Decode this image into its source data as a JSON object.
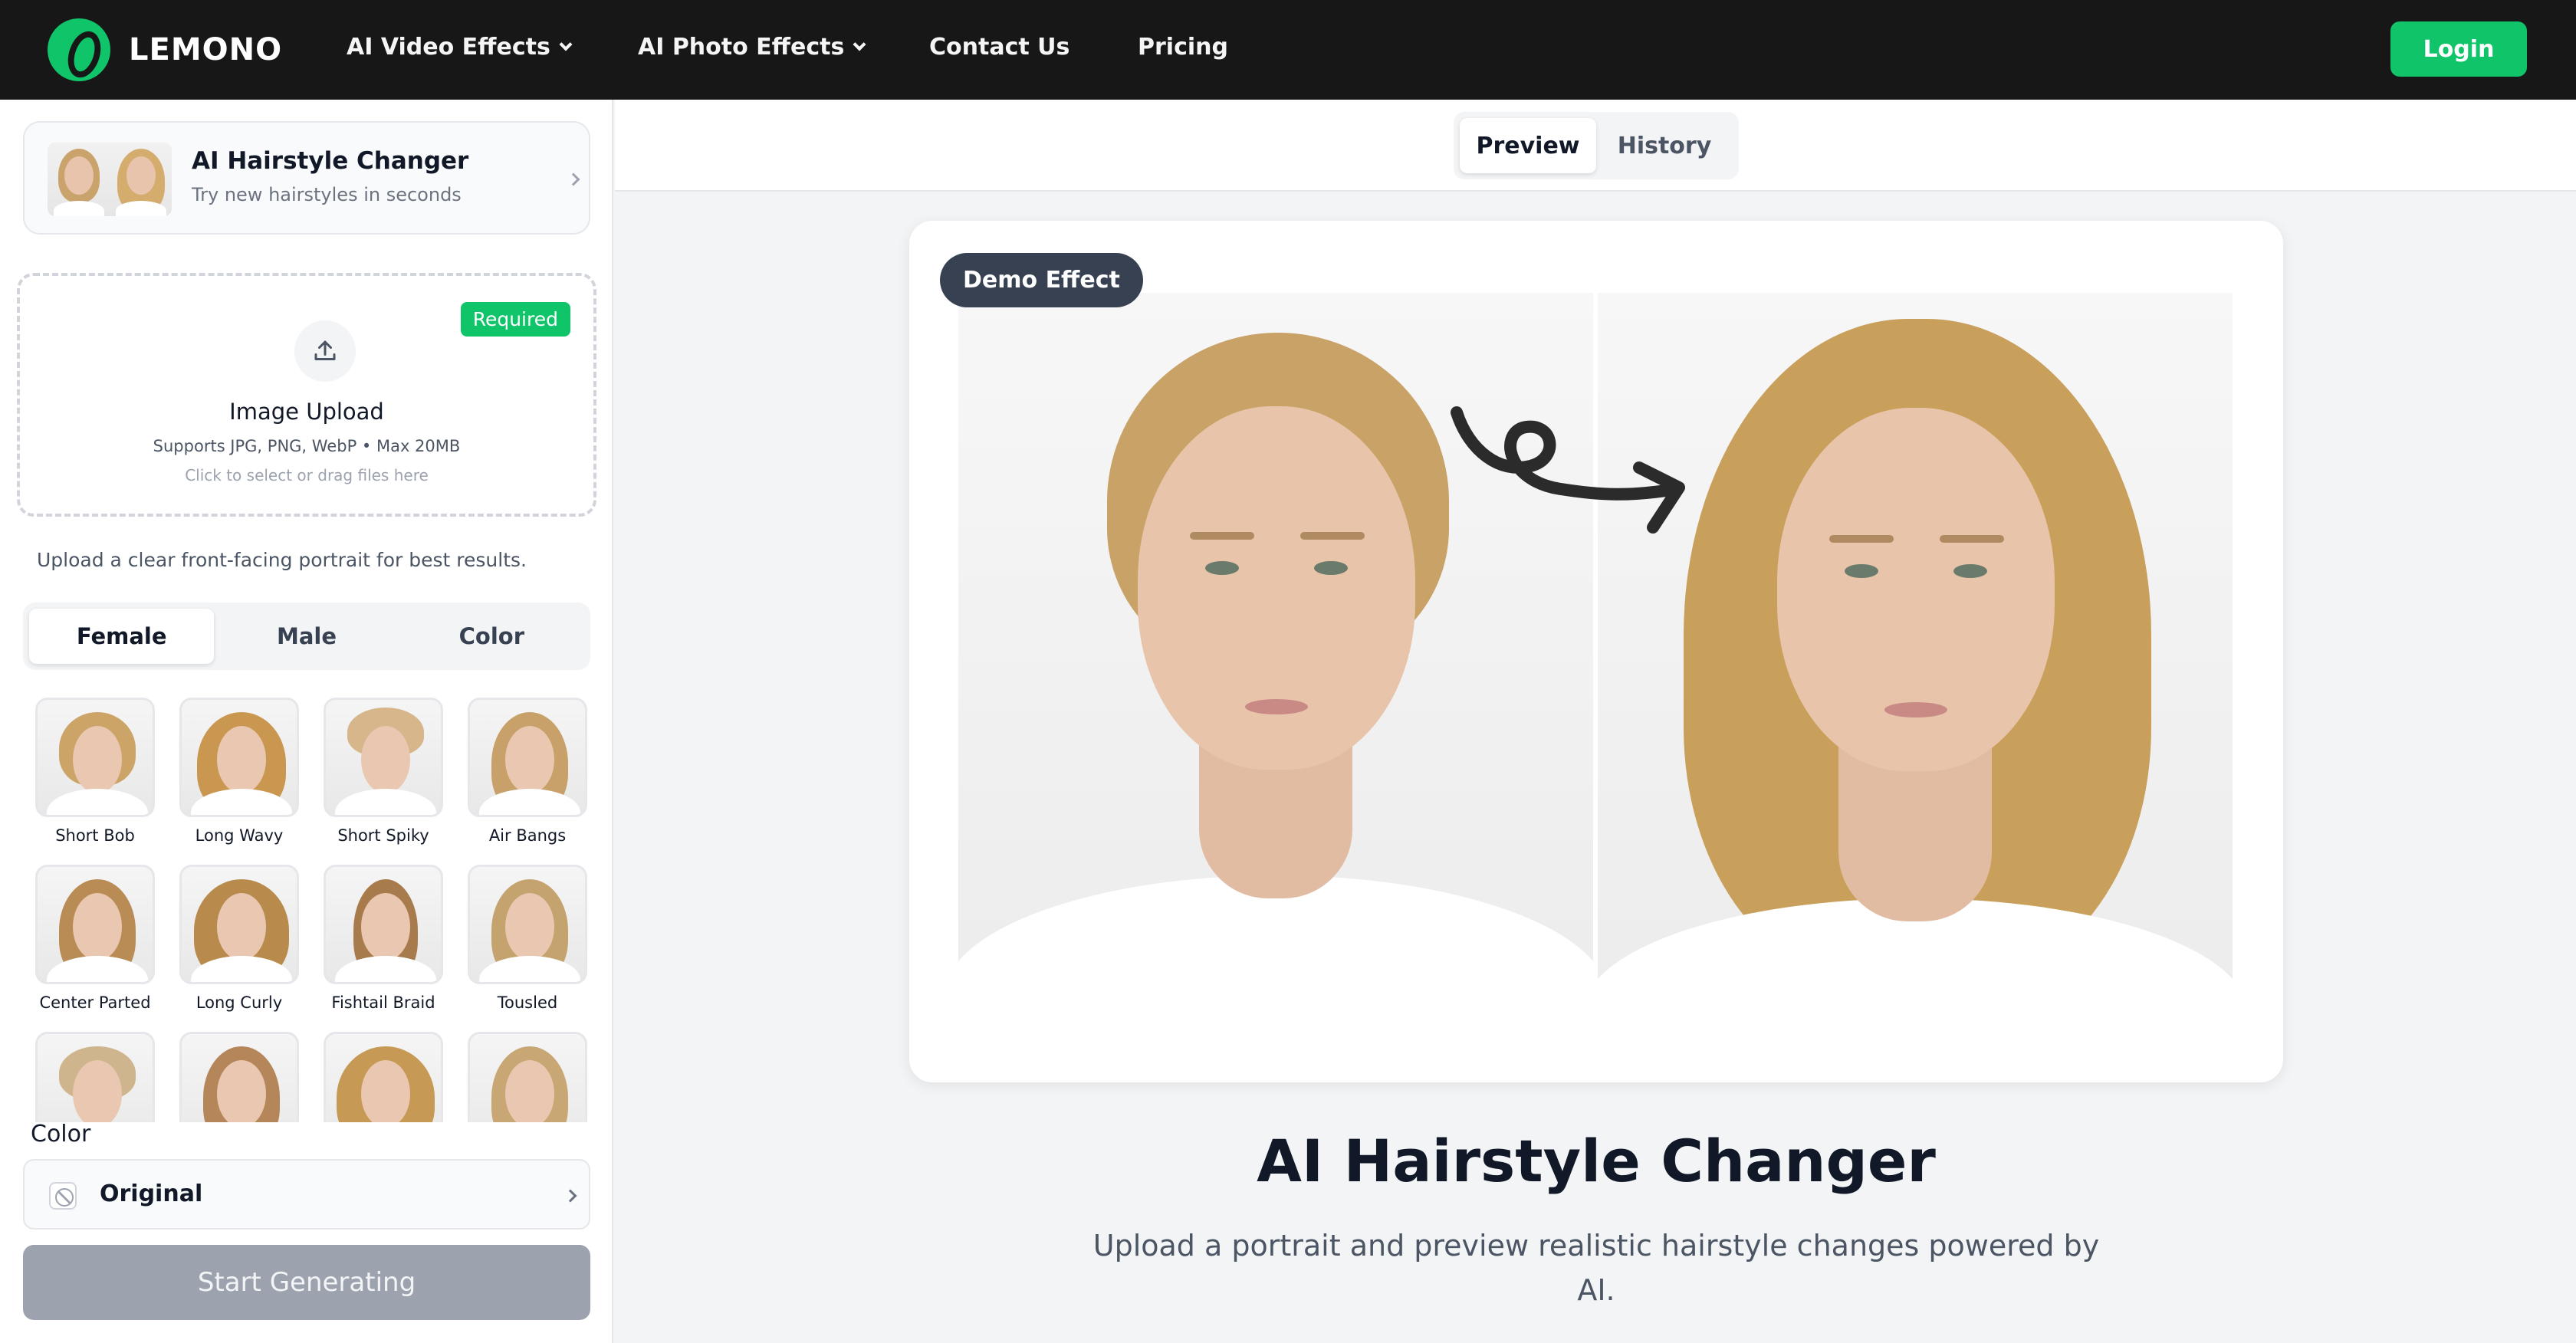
{
  "header": {
    "brand": "LEMONO",
    "nav": [
      {
        "label": "AI Video Effects",
        "dropdown": true
      },
      {
        "label": "AI Photo Effects",
        "dropdown": true
      },
      {
        "label": "Contact Us",
        "dropdown": false
      },
      {
        "label": "Pricing",
        "dropdown": false
      }
    ],
    "login_label": "Login",
    "accent_color": "#10c46a"
  },
  "sidebar": {
    "tool": {
      "title": "AI Hairstyle Changer",
      "subtitle": "Try new hairstyles in seconds"
    },
    "upload": {
      "badge": "Required",
      "title": "Image Upload",
      "formats": "Supports JPG, PNG, WebP • Max 20MB",
      "hint": "Click to select or drag files here",
      "icon": "upload-icon"
    },
    "tip": "Upload a clear front-facing portrait for best results.",
    "tabs": [
      {
        "label": "Female",
        "active": true
      },
      {
        "label": "Male",
        "active": false
      },
      {
        "label": "Color",
        "active": false
      }
    ],
    "styles": [
      {
        "label": "Short Bob"
      },
      {
        "label": "Long Wavy"
      },
      {
        "label": "Short Spiky"
      },
      {
        "label": "Air Bangs"
      },
      {
        "label": "Center Parted"
      },
      {
        "label": "Long Curly"
      },
      {
        "label": "Fishtail Braid"
      },
      {
        "label": "Tousled"
      },
      {
        "label": ""
      },
      {
        "label": ""
      },
      {
        "label": ""
      },
      {
        "label": ""
      }
    ],
    "color_section_label": "Color",
    "color_value": "Original",
    "start_label": "Start Generating"
  },
  "main": {
    "view_tabs": [
      {
        "label": "Preview",
        "active": true
      },
      {
        "label": "History",
        "active": false
      }
    ],
    "demo_badge": "Demo Effect",
    "headline": "AI Hairstyle Changer",
    "description": "Upload a portrait and preview realistic hairstyle changes powered by AI."
  }
}
